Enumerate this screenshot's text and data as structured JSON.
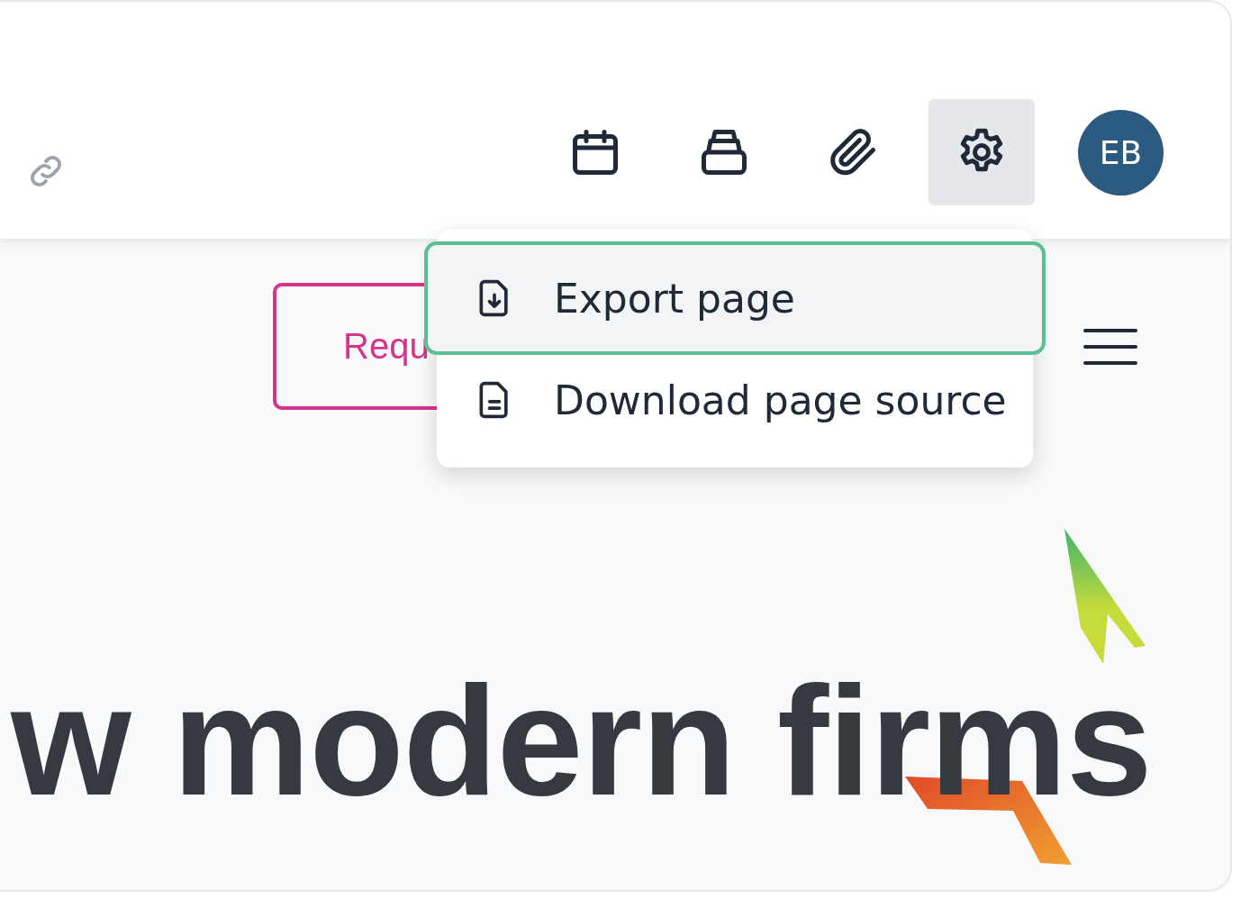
{
  "toolbar": {
    "buttons": [
      {
        "kind": "calendar",
        "active": false
      },
      {
        "kind": "stack",
        "active": false
      },
      {
        "kind": "paperclip",
        "active": false
      },
      {
        "kind": "settings",
        "active": true
      }
    ],
    "avatar": {
      "initials": "EB"
    }
  },
  "hero": {
    "button": {
      "label": "Requ"
    },
    "heading": [
      "w modern firms"
    ]
  },
  "menu": {
    "items": [
      {
        "kind": "export",
        "label": "Export page",
        "highlighted": true
      },
      {
        "kind": "source",
        "label": "Download page source",
        "highlighted": false
      }
    ]
  }
}
